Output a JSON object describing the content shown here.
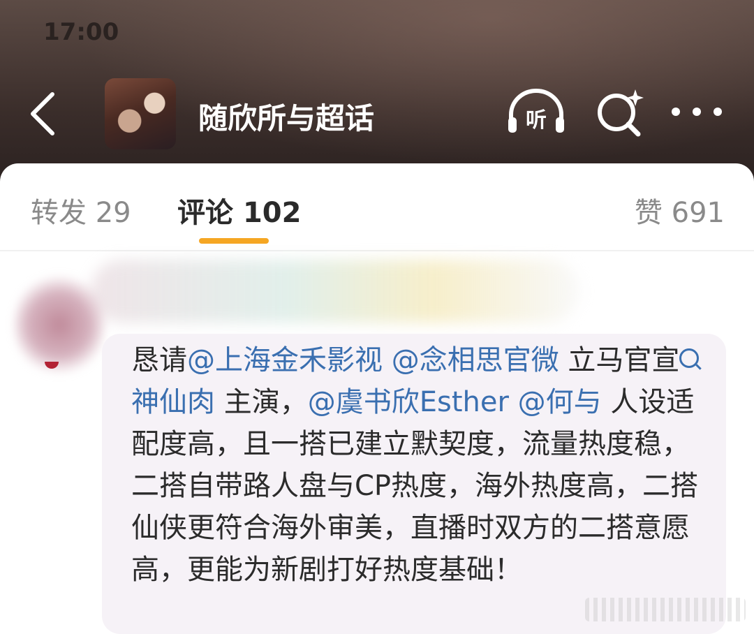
{
  "status_bar": {
    "time": "17:00"
  },
  "header": {
    "title": "随欣所与超话",
    "listen_label": "听",
    "icons": {
      "back": "back-chevron-icon",
      "listen": "headphones-icon",
      "search": "search-sparkle-icon",
      "more": "more-dots-icon"
    }
  },
  "tabs": {
    "repost": {
      "label": "转发",
      "count": "29"
    },
    "comment": {
      "label": "评论",
      "count": "102",
      "active": true
    },
    "like": {
      "label": "赞",
      "count": "691"
    },
    "accent_color": "#f5a623"
  },
  "comment": {
    "segments": [
      {
        "type": "text",
        "text": "恳请"
      },
      {
        "type": "mention",
        "text": "@上海金禾影视"
      },
      {
        "type": "text",
        "text": " "
      },
      {
        "type": "mention",
        "text": "@念相思官微"
      },
      {
        "type": "text",
        "text": " 立马官宣"
      },
      {
        "type": "topic",
        "text": "神仙肉"
      },
      {
        "type": "text",
        "text": " 主演，"
      },
      {
        "type": "mention",
        "text": "@虞书欣Esther"
      },
      {
        "type": "text",
        "text": " "
      },
      {
        "type": "mention",
        "text": "@何与"
      },
      {
        "type": "text",
        "text": " 人设适配度高，且一搭已建立默契度，流量热度稳，二搭自带路人盘与CP热度，海外热度高，二搭仙侠更符合海外审美，直播时双方的二搭意愿高，更能为新剧打好热度基础！"
      }
    ],
    "mention_color": "#3a6fb0"
  }
}
